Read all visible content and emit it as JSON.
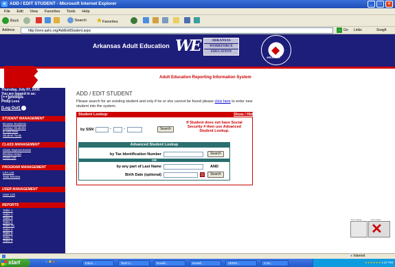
{
  "window": {
    "title": "ADD / EDIT STUDENT - Microsoft Internet Explorer",
    "min_label": "_",
    "max_label": "□",
    "close_label": "×"
  },
  "menu": [
    "File",
    "Edit",
    "View",
    "Favorites",
    "Tools",
    "Help"
  ],
  "toolbar": {
    "back_label": "Back",
    "search_label": "Search",
    "favorites_label": "Favorites"
  },
  "address": {
    "label": "Address",
    "url": "http://zero.aahc.org/AddEditStudent.aspx",
    "go_label": "Go",
    "links_label": "Links",
    "snagit_label": "SnagIt"
  },
  "banner": {
    "title": "Arkansas Adult Education",
    "logo_mark": "WE",
    "logo_lines": [
      "ARKANSAS",
      "WORKFORCE",
      "EDUCATION"
    ],
    "seal_text": "ARKANSAS",
    "system_title": "Adult Education Reporting Information System"
  },
  "sidebar": {
    "date": "Thursday, July 07, 2005",
    "logged_in_as": "You are logged in as:",
    "user_id": "[++]phillips",
    "user_name": "Philip Less",
    "logout_label": "[Log Out]",
    "sections": [
      {
        "title": "STUDENT MANAGEMENT",
        "links": [
          "Browse Students",
          "Lookup Students",
          "& Add New",
          "Student Tools"
        ]
      },
      {
        "title": "CLASS MANAGEMENT",
        "links": [
          "Class Improvements",
          "Review Head",
          "Class List"
        ]
      },
      {
        "title": "PROGRAM MANAGEMENT",
        "links": [
          "LEA List",
          "Task Review"
        ]
      },
      {
        "title": "USER MANAGEMENT",
        "links": [
          "User List"
        ]
      },
      {
        "title": "REPORTS",
        "links": [
          "Table 1",
          "Table 2",
          "Table 3",
          "Table 4",
          "Table 4b",
          "Table 5",
          "Table 6",
          "Table 7",
          "Table 8"
        ]
      }
    ]
  },
  "main": {
    "heading": "ADD / EDIT STUDENT",
    "intro_before": "Please search for an existing student and only if he or she cannot be found please ",
    "intro_link": "click here",
    "intro_after": " to enter new student into the system.",
    "lookup": {
      "title": "Student Lookup:",
      "show_hide": "Show / Hide",
      "ssn_label": "by SSN",
      "ssn_dash": "-",
      "search_button": "Search",
      "ssn_note": "If Student does not have Social Security # then use Advanced Student Lookup.",
      "advanced": {
        "title": "Advanced Student Lookup",
        "tax_label": "by Tax Identification Number",
        "or_label": "OR",
        "last_name_label": "by any part of Last Name",
        "and_label": "AND",
        "birth_label": "Birth Date (optional)",
        "search_button": "Search"
      }
    }
  },
  "thumbnail": {
    "label_left": "Pre Lookup",
    "label_right": "Ad Lookup",
    "mark": "✕"
  },
  "statusbar": {
    "zone": "Internet"
  },
  "taskbar": {
    "start_label": "start",
    "tasks": [
      "Inbox ...",
      "Tech C...",
      "Novell...",
      "Novell...",
      "AERIS...",
      "2 Int..."
    ],
    "clock": "1:37 PM"
  }
}
